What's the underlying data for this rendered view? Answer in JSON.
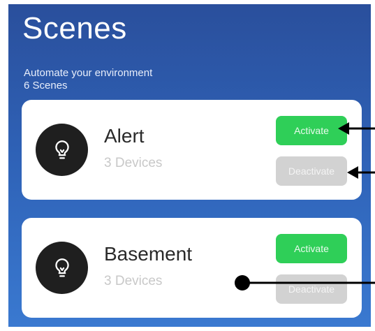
{
  "header": {
    "title": "Scenes",
    "subtitle": "Automate your environment",
    "count": "6 Scenes"
  },
  "scenes": [
    {
      "name": "Alert",
      "devices": "3 Devices",
      "activate_label": "Activate",
      "deactivate_label": "Deactivate",
      "icon": "lightbulb-icon"
    },
    {
      "name": "Basement",
      "devices": "3 Devices",
      "activate_label": "Activate",
      "deactivate_label": "Deactivate",
      "icon": "lightbulb-icon"
    }
  ],
  "colors": {
    "background": "#2f63b8",
    "activate": "#2fcf58",
    "deactivate": "#d2d2d2",
    "card": "#ffffff",
    "icon_bg": "#1f1f1f"
  }
}
